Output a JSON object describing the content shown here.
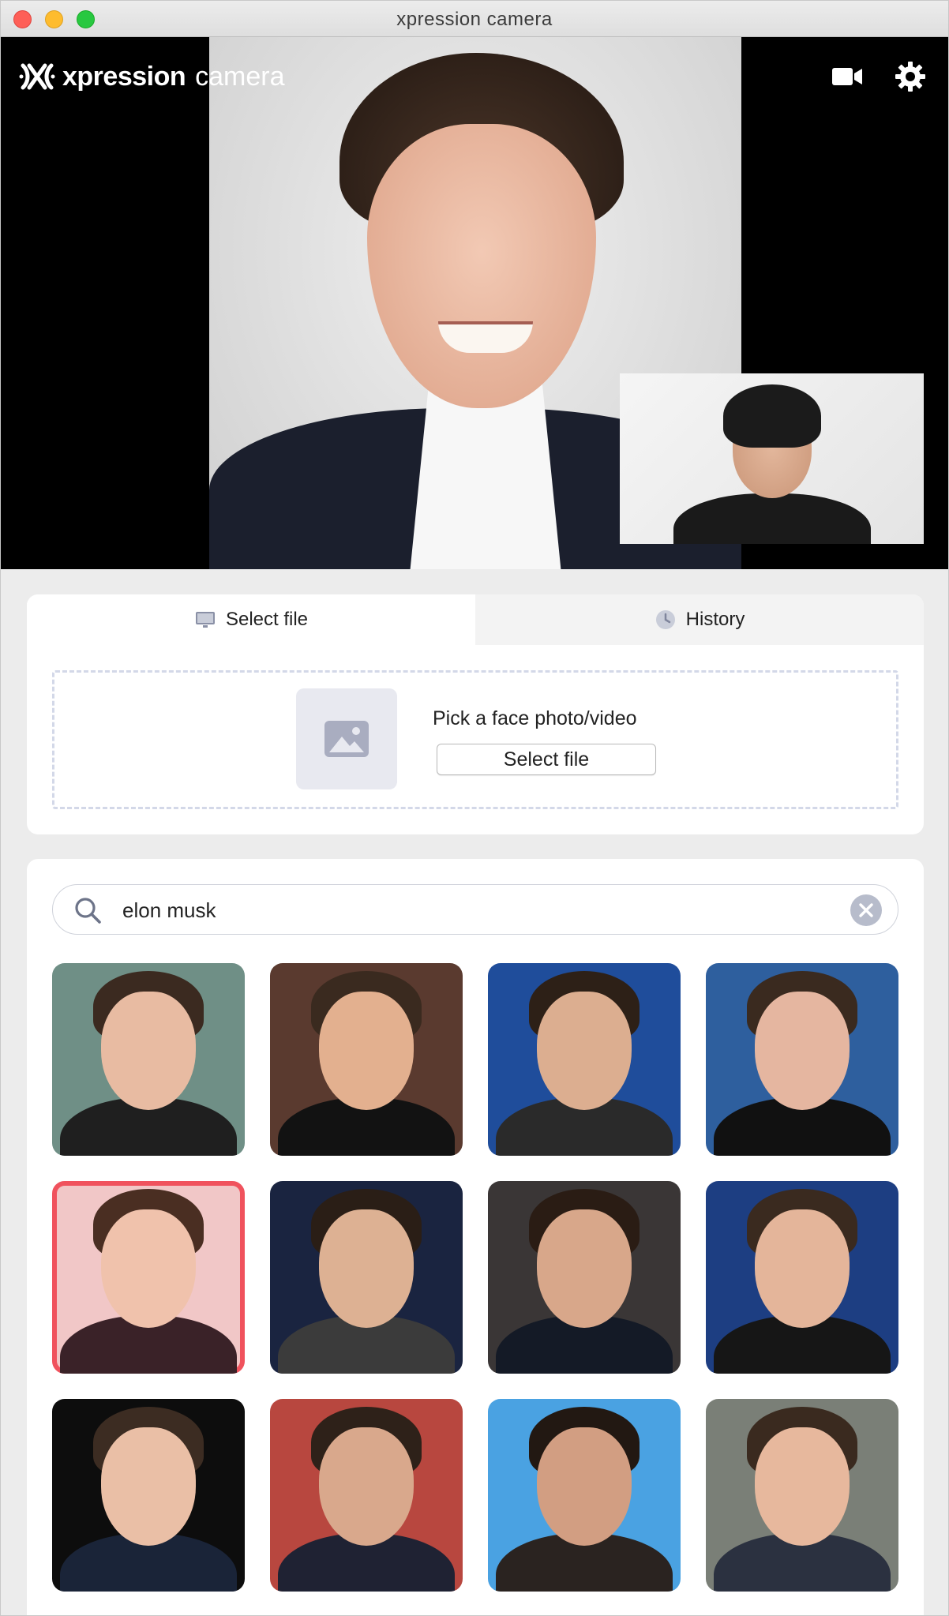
{
  "window": {
    "title": "xpression camera"
  },
  "brand": {
    "word1": "xpression",
    "word2": "camera"
  },
  "toolbar": {
    "camera_icon": "video-camera-icon",
    "settings_icon": "gear-icon"
  },
  "tabs": [
    {
      "label": "Select file",
      "icon": "monitor-icon",
      "active": true
    },
    {
      "label": "History",
      "icon": "clock-icon",
      "active": false
    }
  ],
  "file_picker": {
    "prompt": "Pick a face photo/video",
    "button_label": "Select file"
  },
  "search": {
    "value": "elon musk",
    "placeholder": ""
  },
  "results": {
    "selected_index": 4,
    "items": [
      {
        "bg": "#6f8f86",
        "hair": "#3b2a20",
        "skin": "#e8bba2",
        "body": "#1f1f1f"
      },
      {
        "bg": "#5a3a2f",
        "hair": "#3a2a1f",
        "skin": "#e3b08f",
        "body": "#121212"
      },
      {
        "bg": "#1f4d9b",
        "hair": "#2d2017",
        "skin": "#dcae90",
        "body": "#2a2a2a"
      },
      {
        "bg": "#2e5f9e",
        "hair": "#3a2a1f",
        "skin": "#e5b6a0",
        "body": "#111111"
      },
      {
        "bg": "#f1c7c7",
        "hair": "#4a2e22",
        "skin": "#f0c2ac",
        "body": "#3a2228"
      },
      {
        "bg": "#1a2440",
        "hair": "#2a1e16",
        "skin": "#ddb193",
        "body": "#3b3b3b"
      },
      {
        "bg": "#3a3636",
        "hair": "#2a1c14",
        "skin": "#d8a78a",
        "body": "#141a26"
      },
      {
        "bg": "#1d3e82",
        "hair": "#3a2a1f",
        "skin": "#e4b59a",
        "body": "#161616"
      },
      {
        "bg": "#0d0d0d",
        "hair": "#3c2c22",
        "skin": "#eabfa6",
        "body": "#1a2438"
      },
      {
        "bg": "#b8473f",
        "hair": "#2e2119",
        "skin": "#d9a88c",
        "body": "#1f2233"
      },
      {
        "bg": "#4aa2e2",
        "hair": "#221812",
        "skin": "#d29e82",
        "body": "#2a2320"
      },
      {
        "bg": "#7a7f77",
        "hair": "#3a2a1f",
        "skin": "#e7b89d",
        "body": "#2b3140"
      }
    ]
  },
  "colors": {
    "accent_selected": "#f0525d",
    "titlebar": "#e4e4e4",
    "panel_bg": "#ececec"
  }
}
